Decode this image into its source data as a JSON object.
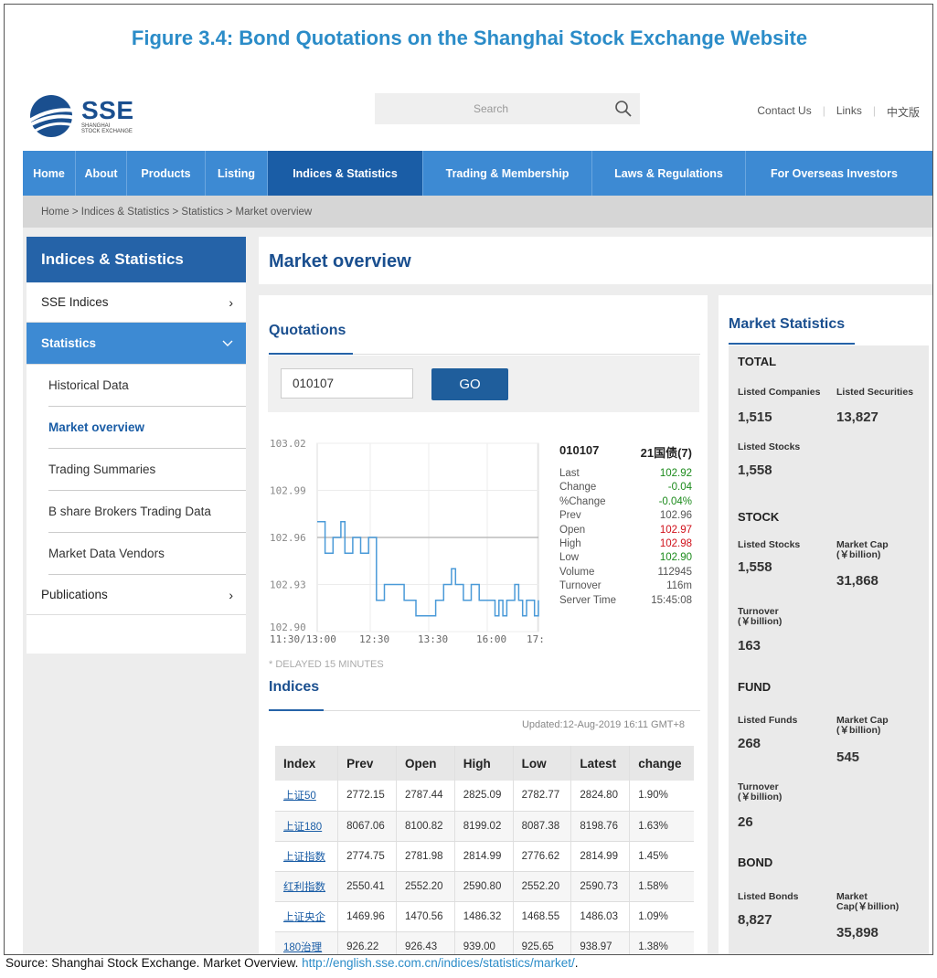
{
  "figure_title": "Figure 3.4: Bond Quotations on the Shanghai Stock Exchange Website",
  "logo": {
    "name": "SSE",
    "sub1": "SHANGHAI",
    "sub2": "STOCK EXCHANGE"
  },
  "search": {
    "placeholder": "Search"
  },
  "top_links": [
    "Contact Us",
    "Links",
    "中文版"
  ],
  "nav": [
    "Home",
    "About",
    "Products",
    "Listing",
    "Indices & Statistics",
    "Trading & Membership",
    "Laws & Regulations",
    "For Overseas Investors"
  ],
  "breadcrumb": "Home > Indices & Statistics > Statistics > Market overview",
  "sidebar": {
    "title": "Indices & Statistics",
    "items": [
      "SSE Indices",
      "Statistics",
      "Publications"
    ],
    "sub_items": [
      "Historical Data",
      "Market overview",
      "Trading Summaries",
      "B share Brokers Trading Data",
      "Market Data Vendors"
    ]
  },
  "page_title": "Market overview",
  "quotations": {
    "title": "Quotations",
    "input_value": "010107",
    "go_label": "GO",
    "delayed": "* DELAYED 15 MINUTES",
    "code": "010107",
    "name": "21国债(7)",
    "rows": [
      {
        "label": "Last",
        "value": "102.92",
        "color": "green"
      },
      {
        "label": "Change",
        "value": "-0.04",
        "color": "green"
      },
      {
        "label": "%Change",
        "value": "-0.04%",
        "color": "green"
      },
      {
        "label": "Prev",
        "value": "102.96",
        "color": "normal"
      },
      {
        "label": "Open",
        "value": "102.97",
        "color": "red"
      },
      {
        "label": "High",
        "value": "102.98",
        "color": "red"
      },
      {
        "label": "Low",
        "value": "102.90",
        "color": "green"
      },
      {
        "label": "Volume",
        "value": "112945",
        "color": "normal"
      },
      {
        "label": "Turnover",
        "value": "116m",
        "color": "normal"
      },
      {
        "label": "Server Time",
        "value": "15:45:08",
        "color": "normal"
      }
    ]
  },
  "chart_data": {
    "type": "line",
    "y_ticks": [
      "103.02",
      "102.99",
      "102.96",
      "102.93",
      "102.90"
    ],
    "x_ticks": [
      "11:30/13:00",
      "12:30",
      "13:30",
      "16:00",
      "17:"
    ],
    "ylim": [
      102.9,
      103.02
    ],
    "prev_close": 102.96,
    "values": [
      102.97,
      102.97,
      102.95,
      102.95,
      102.96,
      102.96,
      102.97,
      102.95,
      102.95,
      102.96,
      102.96,
      102.95,
      102.95,
      102.96,
      102.96,
      102.92,
      102.92,
      102.93,
      102.93,
      102.93,
      102.93,
      102.93,
      102.92,
      102.92,
      102.92,
      102.91,
      102.91,
      102.91,
      102.91,
      102.91,
      102.92,
      102.92,
      102.93,
      102.93,
      102.94,
      102.93,
      102.93,
      102.92,
      102.92,
      102.93,
      102.93,
      102.92,
      102.92,
      102.92,
      102.92,
      102.91,
      102.92,
      102.91,
      102.92,
      102.92,
      102.93,
      102.92,
      102.91,
      102.92,
      102.92,
      102.91,
      102.92
    ]
  },
  "indices": {
    "title": "Indices",
    "updated": "Updated:12-Aug-2019 16:11 GMT+8",
    "headers": [
      "Index",
      "Prev",
      "Open",
      "High",
      "Low",
      "Latest",
      "change"
    ],
    "rows": [
      [
        "上证50",
        "2772.15",
        "2787.44",
        "2825.09",
        "2782.77",
        "2824.80",
        "1.90%"
      ],
      [
        "上证180",
        "8067.06",
        "8100.82",
        "8199.02",
        "8087.38",
        "8198.76",
        "1.63%"
      ],
      [
        "上证指数",
        "2774.75",
        "2781.98",
        "2814.99",
        "2776.62",
        "2814.99",
        "1.45%"
      ],
      [
        "红利指数",
        "2550.41",
        "2552.20",
        "2590.80",
        "2552.20",
        "2590.73",
        "1.58%"
      ],
      [
        "上证央企",
        "1469.96",
        "1470.56",
        "1486.32",
        "1468.55",
        "1486.03",
        "1.09%"
      ],
      [
        "180治理",
        "926.22",
        "926.43",
        "939.00",
        "925.65",
        "938.97",
        "1.38%"
      ]
    ]
  },
  "stats": {
    "title": "Market Statistics",
    "total": {
      "heading": "TOTAL",
      "l1": "Listed Companies",
      "v1": "1,515",
      "l2": "Listed Securities",
      "v2": "13,827",
      "l3": "Listed Stocks",
      "v3": "1,558"
    },
    "stock": {
      "heading": "STOCK",
      "l1": "Listed Stocks",
      "v1": "1,558",
      "l2a": "Market Cap",
      "l2b": "(￥billion)",
      "v2": "31,868",
      "l3a": "Turnover",
      "l3b": "(￥billion)",
      "v3": "163"
    },
    "fund": {
      "heading": "FUND",
      "l1": "Listed Funds",
      "v1": "268",
      "l2a": "Market Cap",
      "l2b": "(￥billion)",
      "v2": "545",
      "l3a": "Turnover",
      "l3b": "(￥billion)",
      "v3": "26"
    },
    "bond": {
      "heading": "BOND",
      "l1": "Listed Bonds",
      "v1": "8,827",
      "l2a": "Market",
      "l2b": "Cap(￥billion)",
      "v2": "35,898"
    }
  },
  "source": {
    "text": "Source: Shanghai Stock Exchange. Market Overview. ",
    "url": "http://english.sse.com.cn/indices/statistics/market/",
    "end": "."
  }
}
